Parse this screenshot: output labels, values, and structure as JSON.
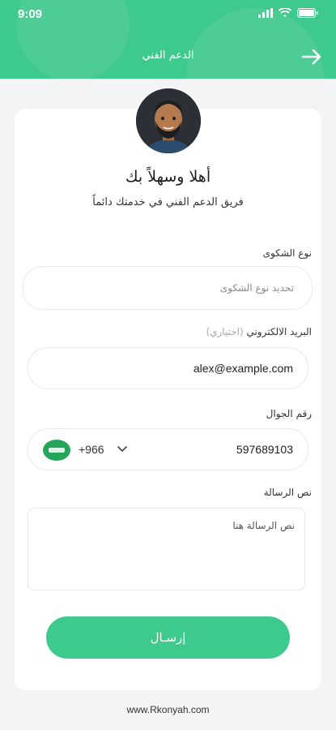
{
  "status_bar": {
    "time": "9:09"
  },
  "header": {
    "title": "الدعم الفني"
  },
  "welcome": {
    "title": "أهلا وسهلاً بك",
    "subtitle": "فريق الدعم الفني في خدمتك دائماً"
  },
  "complaint": {
    "label": "نوع الشكوى",
    "placeholder": "تحديد نوع الشكوى"
  },
  "email": {
    "label": "البريد الالكتروني",
    "optional": "(اختياري)",
    "value": "alex@example.com"
  },
  "phone": {
    "label": "رقم الجوال",
    "country_code": "+966",
    "value": "597689103"
  },
  "message": {
    "label": "نص الرسالة",
    "placeholder": "نص الرسالة هنا"
  },
  "submit_label": "إرسـال",
  "footer": "www.Rkonyah.com",
  "colors": {
    "accent": "#3ec98d",
    "background": "#f3f4f6"
  }
}
